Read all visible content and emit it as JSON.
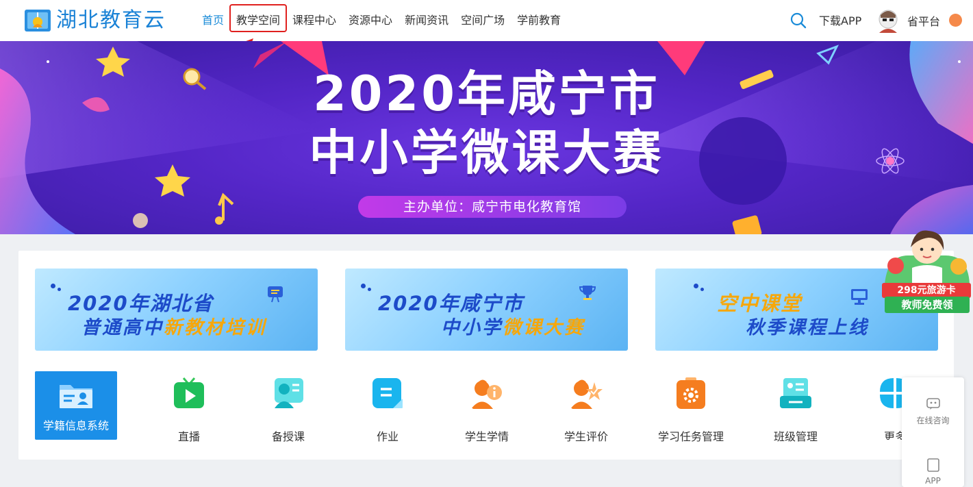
{
  "header": {
    "logo_text": "湖北教育云",
    "nav": [
      {
        "label": "首页",
        "active": true
      },
      {
        "label": "教学空间",
        "active": false
      },
      {
        "label": "课程中心",
        "active": false
      },
      {
        "label": "资源中心",
        "active": false
      },
      {
        "label": "新闻资讯",
        "active": false
      },
      {
        "label": "空间广场",
        "active": false
      },
      {
        "label": "学前教育",
        "active": false
      }
    ],
    "download_label": "下载APP",
    "province_label": "省平台",
    "accent_color": "#1a8bd8"
  },
  "banner": {
    "title_line1": "2020年咸宁市",
    "title_line2": "中小学微课大赛",
    "organizer": "主办单位：咸宁市电化教育馆",
    "slide_count": 5,
    "active_slide": 3
  },
  "promos": [
    {
      "line1": "2020年湖北省",
      "line2_plain": "普通高中",
      "line2_highlight": "新教材培训",
      "icon": "chat-flag-icon"
    },
    {
      "line1": "2020年咸宁市",
      "line2_plain": "中小学",
      "line2_highlight": "微课大赛",
      "icon": "trophy-icon"
    },
    {
      "line1_highlight": "空中课堂",
      "line2_plain": "秋季课程上线",
      "icon": "monitor-icon"
    }
  ],
  "tiles": [
    {
      "label": "学籍信息系统",
      "icon": "id-card-folder-icon",
      "featured": true
    },
    {
      "label": "直播",
      "icon": "live-tv-icon"
    },
    {
      "label": "备授课",
      "icon": "teacher-lesson-icon"
    },
    {
      "label": "作业",
      "icon": "homework-icon"
    },
    {
      "label": "学生学情",
      "icon": "student-info-icon"
    },
    {
      "label": "学生评价",
      "icon": "student-evaluation-icon"
    },
    {
      "label": "学习任务管理",
      "icon": "task-gear-icon"
    },
    {
      "label": "班级管理",
      "icon": "class-management-icon"
    },
    {
      "label": "更多",
      "icon": "more-apps-icon"
    }
  ],
  "float_promo": {
    "line1": "298元旅游卡",
    "line2": "教师免费领"
  },
  "side_panel": {
    "consult_label": "在线咨询",
    "app_label": "APP"
  }
}
